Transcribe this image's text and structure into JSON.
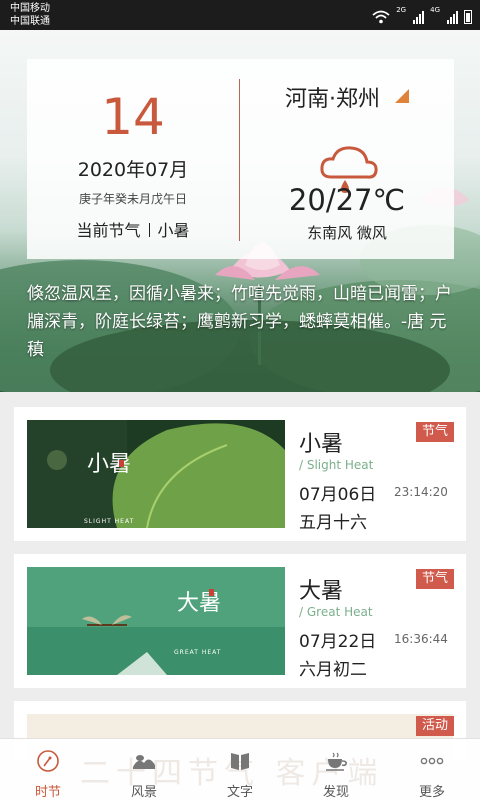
{
  "status": {
    "carrier1": "中国移动",
    "carrier2": "中国联通",
    "net1": "2G",
    "net2": "4G"
  },
  "hero": {
    "day": "14",
    "year_month": "2020年07月",
    "ganzhi": "庚子年癸未月戊午日",
    "term_label": "当前节气",
    "term_value": "小暑",
    "city": "河南·郑州",
    "temp": "20/27℃",
    "wind": "东南风 微风",
    "weather_icon": "rain-cloud-icon",
    "poem": "倏忽温风至，因循小暑来；竹喧先觉雨，山暗已闻雷；户牖深青，阶庭长绿苔；鹰鹯新习学，蟋蟀莫相催。-唐 元稹"
  },
  "items": [
    {
      "title": "小暑",
      "en": "/ Slight Heat",
      "date": "07月06日",
      "lunar": "五月十六",
      "time": "23:14:20",
      "badge": "节气",
      "thumb_cn": "小暑",
      "thumb_en": "SLIGHT HEAT"
    },
    {
      "title": "大暑",
      "en": "/ Great Heat",
      "date": "07月22日",
      "lunar": "六月初二",
      "time": "16:36:44",
      "badge": "节气",
      "thumb_cn": "大暑",
      "thumb_en": "GREAT HEAT"
    },
    {
      "badge": "活动",
      "banner": "二十四节气 客户端"
    }
  ],
  "tabs": [
    {
      "label": "时节",
      "icon": "compass-icon",
      "active": true
    },
    {
      "label": "风景",
      "icon": "landscape-icon"
    },
    {
      "label": "文字",
      "icon": "book-icon"
    },
    {
      "label": "发现",
      "icon": "tea-cup-icon"
    },
    {
      "label": "更多",
      "icon": "more-dots-icon"
    }
  ],
  "colors": {
    "accent": "#c8593c",
    "badge": "#d05a4b",
    "en_text": "#7bb08c"
  }
}
